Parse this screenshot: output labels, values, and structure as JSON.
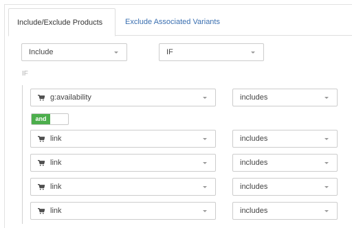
{
  "tabs": [
    {
      "label": "Include/Exclude Products",
      "active": true
    },
    {
      "label": "Exclude Associated Variants",
      "active": false
    }
  ],
  "mode_select": {
    "value": "Include"
  },
  "logic_select": {
    "value": "IF"
  },
  "condition_label": "IF",
  "operator_toggle": {
    "label": "and",
    "color": "#4cae4c"
  },
  "rules": [
    {
      "field": "g:availability",
      "operator": "includes",
      "field_icon": "cart-icon"
    },
    {
      "field": "link",
      "operator": "includes",
      "field_icon": "cart-icon"
    },
    {
      "field": "link",
      "operator": "includes",
      "field_icon": "cart-icon"
    },
    {
      "field": "link",
      "operator": "includes",
      "field_icon": "cart-icon"
    },
    {
      "field": "link",
      "operator": "includes",
      "field_icon": "cart-icon"
    }
  ],
  "colors": {
    "tab_link": "#3a6fb0",
    "toggle_on": "#4cae4c"
  }
}
